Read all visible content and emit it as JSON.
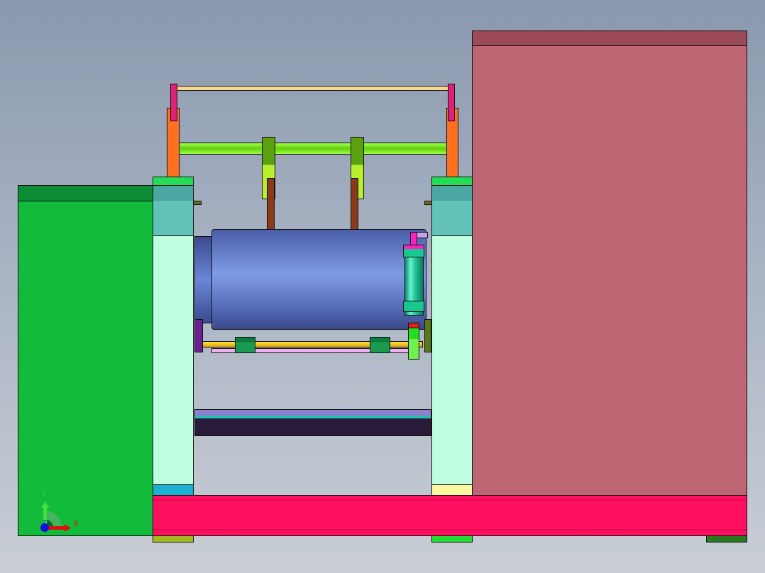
{
  "viewport": {
    "triad": {
      "x_label": "X",
      "y_label": "Y",
      "z_label": "Z"
    },
    "colors": {
      "right_block": "#be6674",
      "left_block": "#12bb3c",
      "base_beam": "#ff1060",
      "roller": "#6a86d6"
    }
  }
}
